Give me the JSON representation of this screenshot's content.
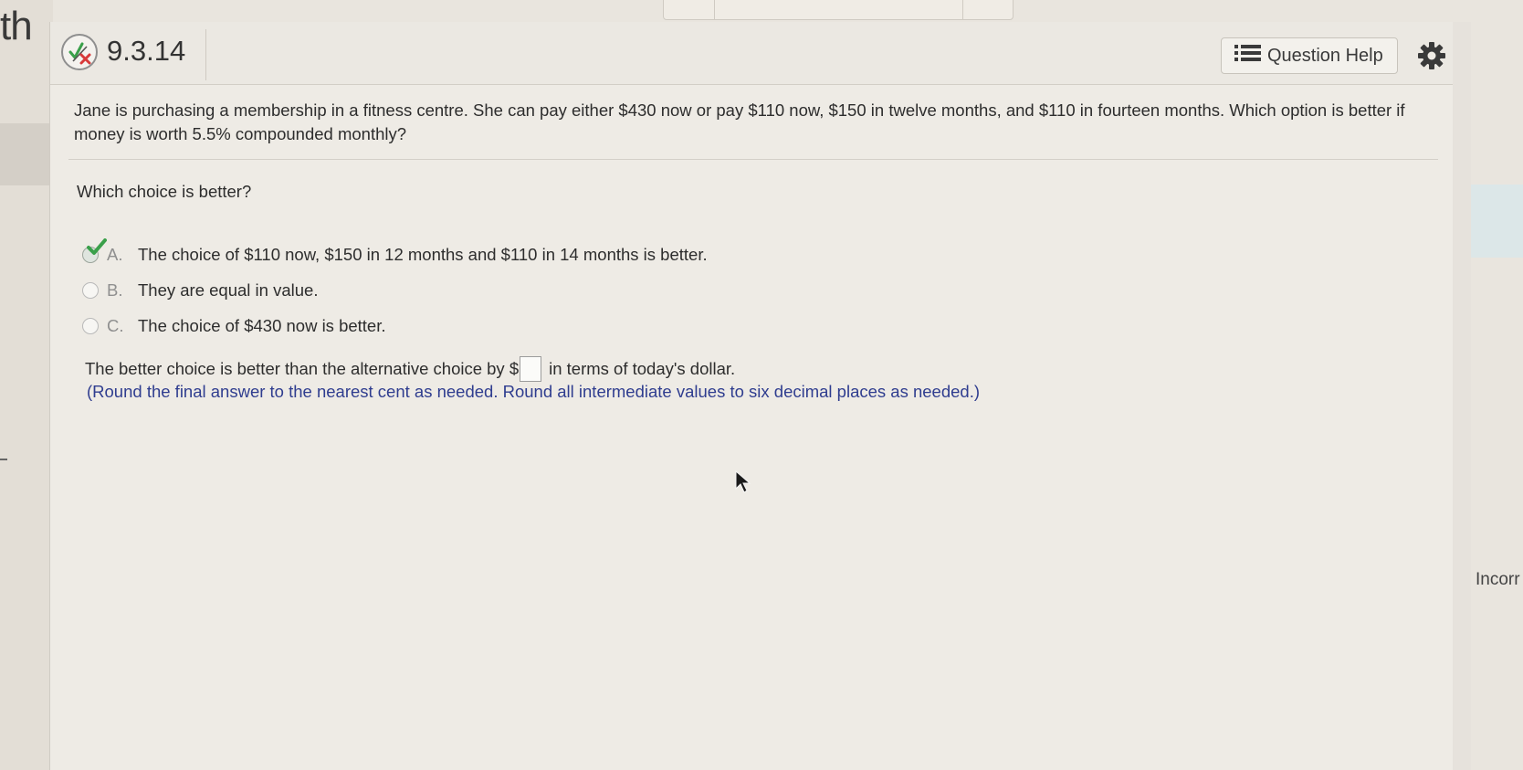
{
  "app": {
    "brand_fragment": "th",
    "status_side_text": "Incorr"
  },
  "question": {
    "number": "9.3.14",
    "help_label": "Question Help",
    "text": "Jane is purchasing a membership in a fitness centre. She can pay either $430 now or pay $110 now, $150 in twelve months, and $110 in fourteen months. Which option is better if money is worth 5.5% compounded monthly?",
    "sub_question": "Which choice is better?",
    "options": [
      {
        "letter": "A.",
        "text": "The choice of $110 now, $150 in 12 months and $110 in 14 months is better.",
        "selected": true,
        "correct": true
      },
      {
        "letter": "B.",
        "text": "They are equal in value.",
        "selected": false
      },
      {
        "letter": "C.",
        "text": "The choice of $430 now is better.",
        "selected": false
      }
    ],
    "answer_prefix": "The better choice is better than the alternative choice by $",
    "answer_value": "",
    "answer_suffix": "in terms of today's dollar.",
    "hint": "(Round the final answer to the nearest cent as needed. Round all intermediate values to six decimal places as needed.)"
  },
  "colors": {
    "hint": "#2f3d8f",
    "correct_check": "#3aa04a",
    "wrong_x": "#d83a3a"
  },
  "icons": {
    "status": "partial-correct-icon",
    "help": "list-icon",
    "settings": "gear-icon"
  }
}
